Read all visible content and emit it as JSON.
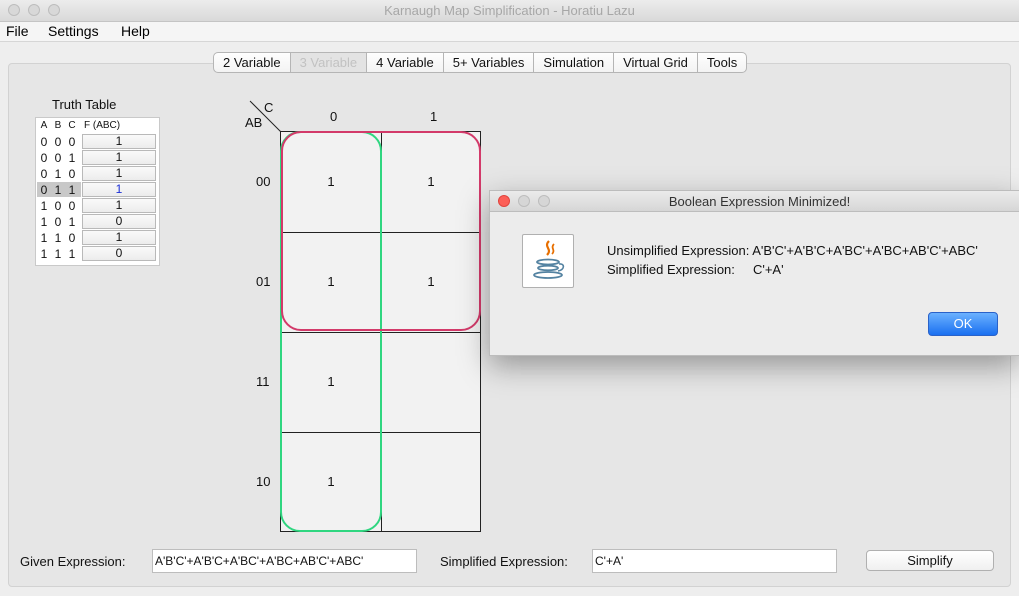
{
  "window": {
    "title": "Karnaugh Map Simplification - Horatiu Lazu"
  },
  "menu": [
    "File",
    "Settings",
    "Help"
  ],
  "tabs": [
    {
      "label": "2 Variable",
      "selected": false
    },
    {
      "label": "3 Variable",
      "selected": true
    },
    {
      "label": "4 Variable",
      "selected": false
    },
    {
      "label": "5+ Variables",
      "selected": false
    },
    {
      "label": "Simulation",
      "selected": false
    },
    {
      "label": "Virtual Grid",
      "selected": false
    },
    {
      "label": "Tools",
      "selected": false
    }
  ],
  "truth_table": {
    "title": "Truth Table",
    "headers": [
      "A",
      "B",
      "C",
      "F (ABC)"
    ],
    "rows": [
      {
        "bits": [
          "0",
          "0",
          "0"
        ],
        "value": "1"
      },
      {
        "bits": [
          "0",
          "0",
          "1"
        ],
        "value": "1"
      },
      {
        "bits": [
          "0",
          "1",
          "0"
        ],
        "value": "1"
      },
      {
        "bits": [
          "0",
          "1",
          "1"
        ],
        "value": "1",
        "highlighted": true
      },
      {
        "bits": [
          "1",
          "0",
          "0"
        ],
        "value": "1"
      },
      {
        "bits": [
          "1",
          "0",
          "1"
        ],
        "value": "0"
      },
      {
        "bits": [
          "1",
          "1",
          "0"
        ],
        "value": "1"
      },
      {
        "bits": [
          "1",
          "1",
          "1"
        ],
        "value": "0"
      }
    ]
  },
  "kmap": {
    "corner_col_var": "C",
    "corner_row_var": "AB",
    "col_labels": [
      "0",
      "1"
    ],
    "row_labels": [
      "00",
      "01",
      "11",
      "10"
    ],
    "cells": [
      [
        "1",
        "1"
      ],
      [
        "1",
        "1"
      ],
      [
        "1",
        ""
      ],
      [
        "1",
        ""
      ]
    ],
    "group_colors": {
      "red": "#d33a6a",
      "green": "#2fd680"
    }
  },
  "bottom": {
    "given_label": "Given Expression:",
    "given_value": "A'B'C'+A'B'C+A'BC'+A'BC+AB'C'+ABC'",
    "simplified_label": "Simplified Expression:",
    "simplified_value": "C'+A'",
    "simplify_button": "Simplify"
  },
  "dialog": {
    "title": "Boolean Expression Minimized!",
    "line1": "Unsimplified Expression: A'B'C'+A'B'C+A'BC'+A'BC+AB'C'+ABC'",
    "line2": "Simplified Expression:     C'+A'",
    "ok": "OK",
    "icon": "java-coffee-icon"
  }
}
